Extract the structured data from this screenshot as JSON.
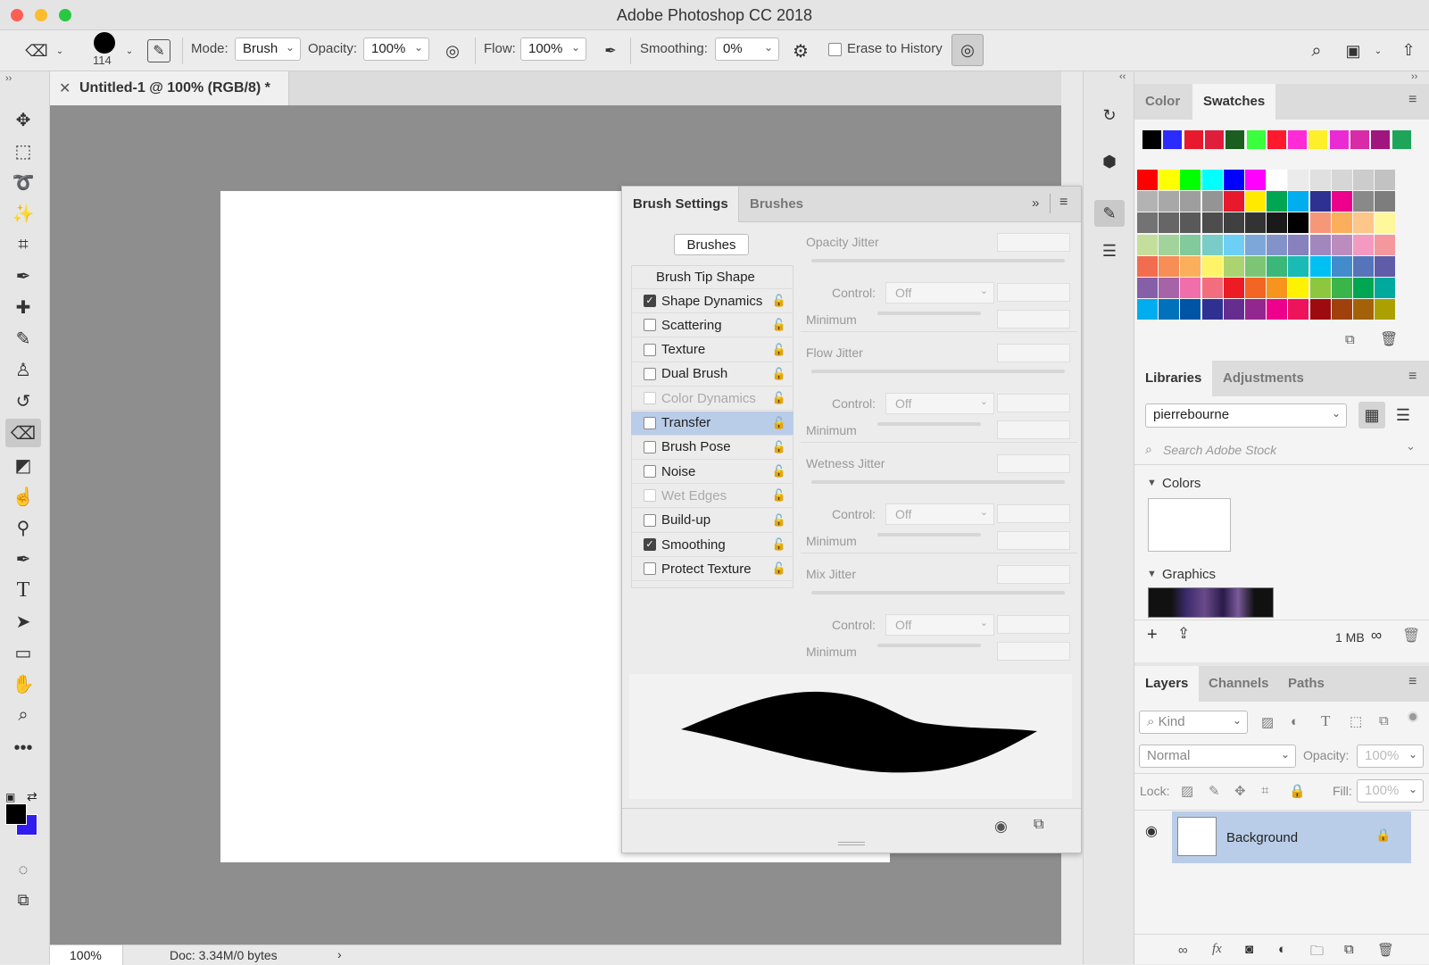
{
  "app": {
    "title": "Adobe Photoshop CC 2018"
  },
  "options_bar": {
    "brush_size": "114",
    "mode_label": "Mode:",
    "mode_value": "Brush",
    "opacity_label": "Opacity:",
    "opacity_value": "100%",
    "flow_label": "Flow:",
    "flow_value": "100%",
    "smoothing_label": "Smoothing:",
    "smoothing_value": "0%",
    "erase_history_label": "Erase to History"
  },
  "document": {
    "tab_title": "Untitled-1 @ 100% (RGB/8) *",
    "zoom": "100%",
    "doc_info": "Doc: 3.34M/0 bytes"
  },
  "brush_panel": {
    "tabs": [
      "Brush Settings",
      "Brushes"
    ],
    "brushes_button": "Brushes",
    "tip_shape": "Brush Tip Shape",
    "options": [
      {
        "label": "Shape Dynamics",
        "checked": true,
        "dim": false
      },
      {
        "label": "Scattering",
        "checked": false,
        "dim": false
      },
      {
        "label": "Texture",
        "checked": false,
        "dim": false
      },
      {
        "label": "Dual Brush",
        "checked": false,
        "dim": false
      },
      {
        "label": "Color Dynamics",
        "checked": false,
        "dim": true
      },
      {
        "label": "Transfer",
        "checked": false,
        "dim": false,
        "selected": true
      },
      {
        "label": "Brush Pose",
        "checked": false,
        "dim": false
      },
      {
        "label": "Noise",
        "checked": false,
        "dim": false
      },
      {
        "label": "Wet Edges",
        "checked": false,
        "dim": true
      },
      {
        "label": "Build-up",
        "checked": false,
        "dim": false
      },
      {
        "label": "Smoothing",
        "checked": true,
        "dim": false
      },
      {
        "label": "Protect Texture",
        "checked": false,
        "dim": false
      }
    ],
    "jitters": [
      {
        "label": "Opacity Jitter",
        "control": "Control:",
        "control_value": "Off",
        "minimum": "Minimum"
      },
      {
        "label": "Flow Jitter",
        "control": "Control:",
        "control_value": "Off",
        "minimum": "Minimum"
      },
      {
        "label": "Wetness Jitter",
        "control": "Control:",
        "control_value": "Off",
        "minimum": "Minimum"
      },
      {
        "label": "Mix Jitter",
        "control": "Control:",
        "control_value": "Off",
        "minimum": "Minimum"
      }
    ]
  },
  "color_panel": {
    "tabs": [
      "Color",
      "Swatches"
    ],
    "recent_swatches": [
      "#000000",
      "#2b2bff",
      "#e8192c",
      "#e01e3c",
      "#1b5e20",
      "#39ff3c",
      "#ff1a2e",
      "#ff2bd6",
      "#ffee2a",
      "#ea2bd4",
      "#d92aa8",
      "#a0167e",
      "#1ea55a"
    ],
    "swatch_grid": [
      [
        "#ff0000",
        "#ffff00",
        "#00ff00",
        "#00ffff",
        "#0000ff",
        "#ff00ff",
        "#ffffff",
        "#ebebeb",
        "#e0e0e0",
        "#d6d6d6",
        "#cccccc",
        "#c2c2c2"
      ],
      [
        "#b3b3b3",
        "#a8a8a8",
        "#9e9e9e",
        "#949494",
        "#e8192c",
        "#ffea00",
        "#00a651",
        "#00aeef",
        "#2e3192",
        "#ec008c",
        "#898989",
        "#7d7d7d"
      ],
      [
        "#737373",
        "#666666",
        "#595959",
        "#4d4d4d",
        "#404040",
        "#333333",
        "#1a1a1a",
        "#000000",
        "#f7977a",
        "#fbaf5d",
        "#fdc68a",
        "#fff79a"
      ],
      [
        "#c4df9b",
        "#a3d39c",
        "#82ca9c",
        "#7accc8",
        "#6dcff6",
        "#7da7d9",
        "#8393ca",
        "#8781bd",
        "#a187be",
        "#bd8cbf",
        "#f49ac1",
        "#f5989d"
      ],
      [
        "#f26c4f",
        "#f68e56",
        "#fbaf5c",
        "#fff467",
        "#acd372",
        "#7cc576",
        "#3bb878",
        "#1abbb4",
        "#00bff3",
        "#438ccb",
        "#5574b9",
        "#605ca8"
      ],
      [
        "#8560a8",
        "#a763a8",
        "#f06ea9",
        "#f26d7d",
        "#ed1c24",
        "#f26522",
        "#f7941d",
        "#fff200",
        "#8dc73f",
        "#39b54a",
        "#00a651",
        "#00a99d"
      ],
      [
        "#00aeef",
        "#0072bc",
        "#0054a6",
        "#2e3192",
        "#662d91",
        "#92278f",
        "#ec008c",
        "#ed145b",
        "#9e0b0f",
        "#a0410d",
        "#a36209",
        "#aba000"
      ]
    ]
  },
  "libraries_panel": {
    "tabs": [
      "Libraries",
      "Adjustments"
    ],
    "library_name": "pierrebourne",
    "search_placeholder": "Search Adobe Stock",
    "colors_section": "Colors",
    "graphics_section": "Graphics",
    "storage": "1 MB"
  },
  "layers_panel": {
    "tabs": [
      "Layers",
      "Channels",
      "Paths"
    ],
    "kind_label": "Kind",
    "blend_mode": "Normal",
    "opacity_label": "Opacity:",
    "opacity_value": "100%",
    "lock_label": "Lock:",
    "fill_label": "Fill:",
    "fill_value": "100%",
    "layer_name": "Background"
  }
}
